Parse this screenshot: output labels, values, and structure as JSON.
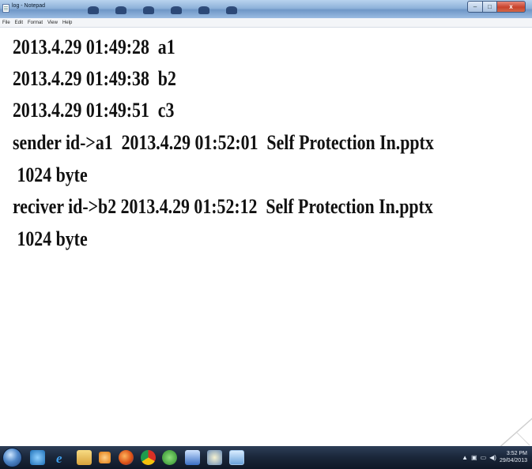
{
  "window": {
    "title": "log - Notepad",
    "controls": {
      "minimize": "–",
      "maximize": "□",
      "close": "x"
    }
  },
  "menu": {
    "items": [
      "File",
      "Edit",
      "Format",
      "View",
      "Help"
    ]
  },
  "editor": {
    "lines": [
      "2013.4.29 01:49:28  a1",
      "2013.4.29 01:49:38  b2",
      "2013.4.29 01:49:51  c3",
      "sender id->a1  2013.4.29 01:52:01  Self Protection In.pptx",
      " 1024 byte",
      "reciver id->b2 2013.4.29 01:52:12  Self Protection In.pptx",
      " 1024 byte"
    ]
  },
  "taskbar": {
    "pinned_icons": [
      "windows-explorer-icon",
      "internet-explorer-icon",
      "folder-icon",
      "media-player-icon",
      "firefox-icon",
      "chrome-icon",
      "utorrent-icon",
      "word-icon",
      "paint-icon",
      "notepad-icon"
    ],
    "tray": {
      "time": "3:52 PM",
      "date": "29/04/2013"
    }
  }
}
